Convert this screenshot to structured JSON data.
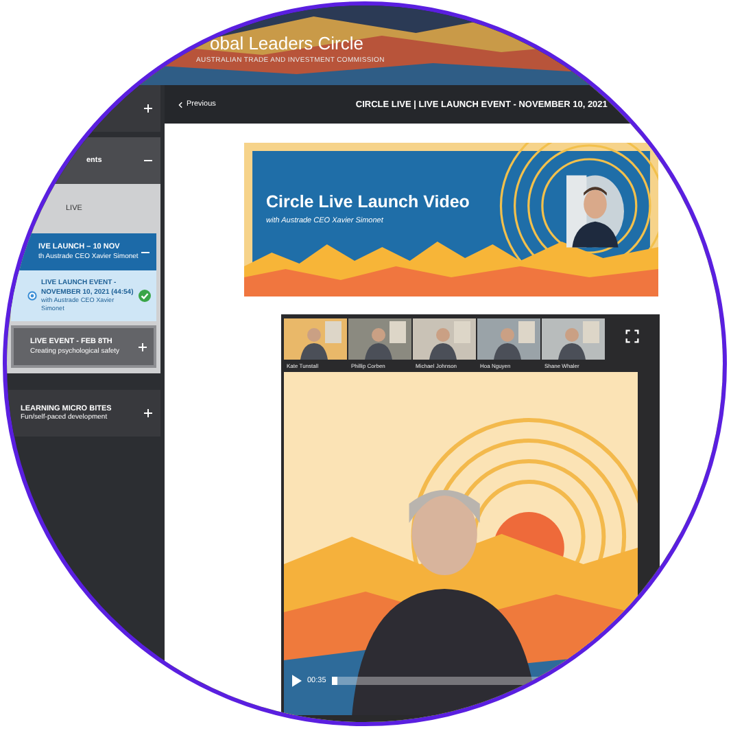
{
  "header": {
    "title": "obal Leaders Circle",
    "subtitle": "AUSTRALIAN TRADE AND INVESTMENT COMMISSION"
  },
  "sidebar": {
    "items": [
      {
        "kind": "module",
        "expanded": false
      },
      {
        "kind": "module",
        "title": "ents",
        "expanded": true,
        "children": [
          {
            "kind": "heading",
            "title": "LIVE"
          },
          {
            "kind": "group",
            "title": "IVE LAUNCH – 10 NOV",
            "subtitle": "th Austrade CEO Xavier Simonet",
            "expanded": true,
            "children": [
              {
                "kind": "lesson",
                "title": "LIVE LAUNCH EVENT - NOVEMBER 10, 2021 (44:54)",
                "subtitle": "with Austrade CEO Xavier Simonet",
                "selected": true,
                "completed": true
              }
            ]
          },
          {
            "kind": "group",
            "title": "LIVE EVENT - FEB 8TH",
            "subtitle": "Creating psychological safety",
            "expanded": false
          }
        ]
      },
      {
        "kind": "module",
        "title": "LEARNING MICRO BITES",
        "subtitle": "Fun/self-paced development",
        "expanded": false
      }
    ]
  },
  "topbar": {
    "back": "Previous",
    "title": "CIRCLE LIVE | LIVE LAUNCH EVENT - NOVEMBER 10, 2021"
  },
  "banner": {
    "title": "Circle Live Launch Video",
    "subtitle": "with Austrade CEO Xavier Simonet"
  },
  "video": {
    "participants": [
      "Kate Tunstall",
      "Phillip Corben",
      "Michael Johnson",
      "Hoa Nguyen",
      "Shane Whaler"
    ],
    "time": "00:35",
    "level": 0.03
  }
}
